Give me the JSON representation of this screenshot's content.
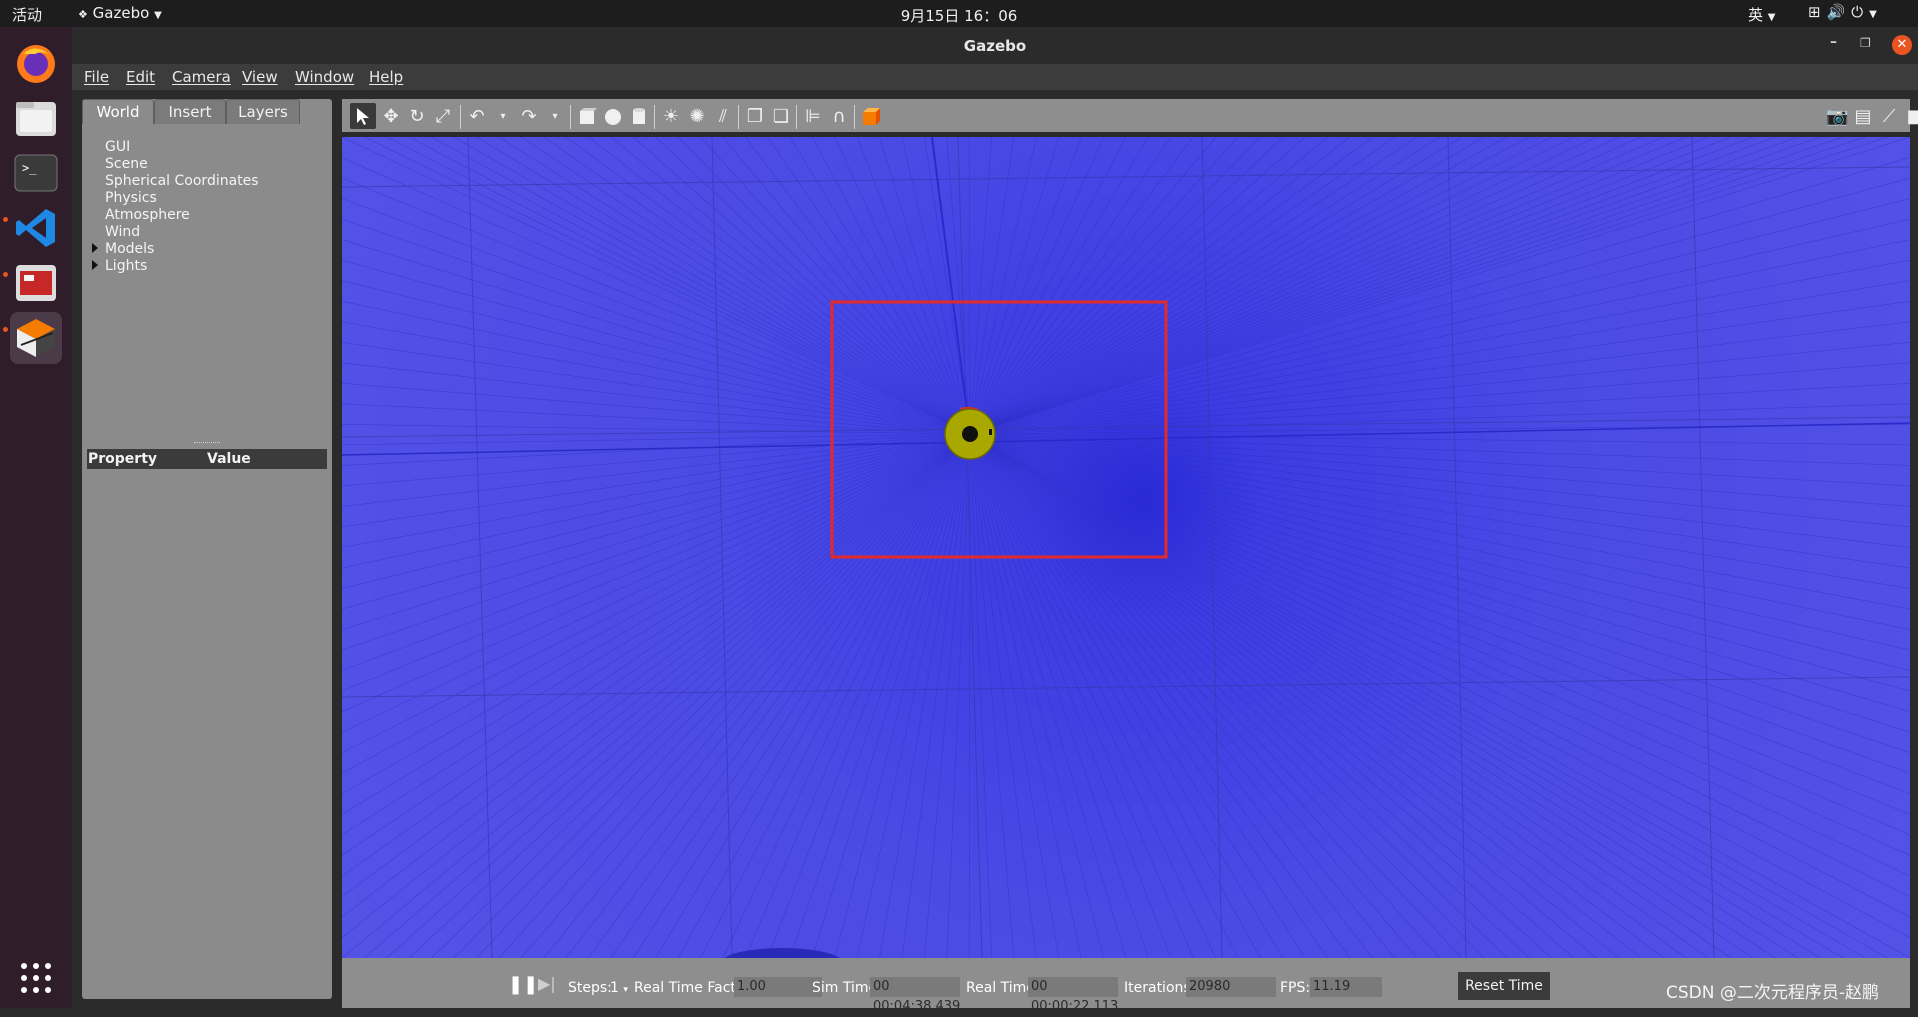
{
  "topbar": {
    "activities": "活动",
    "app_name": "Gazebo",
    "clock": "9月15日 16：06",
    "ime": "英"
  },
  "window": {
    "title": "Gazebo"
  },
  "menu": [
    "File",
    "Edit",
    "Camera",
    "View",
    "Window",
    "Help"
  ],
  "left_panel": {
    "tabs": [
      "World",
      "Insert",
      "Layers"
    ],
    "active_tab": "World",
    "tree": [
      "GUI",
      "Scene",
      "Spherical Coordinates",
      "Physics",
      "Atmosphere",
      "Wind",
      "Models",
      "Lights"
    ],
    "property_header": {
      "property": "Property",
      "value": "Value"
    }
  },
  "toolbar": {
    "tools": [
      "select-arrow-icon",
      "translate-icon",
      "rotate-icon",
      "scale-icon",
      "undo-icon",
      "undo-history-icon",
      "redo-icon",
      "redo-history-icon",
      "box-icon",
      "sphere-icon",
      "cylinder-icon",
      "point-light-icon",
      "spot-light-icon",
      "directional-light-icon",
      "copy-icon",
      "paste-icon",
      "align-icon",
      "snap-icon",
      "view-angle-icon"
    ],
    "right_tools": [
      "screenshot-icon",
      "log-icon",
      "plot-icon",
      "video-record-icon"
    ]
  },
  "bottom": {
    "steps_label": "Steps:",
    "steps_value": "1",
    "rtf_label": "Real Time Factor:",
    "rtf_value": "1.00",
    "sim_label": "Sim Time:",
    "sim_value": "00 00:04:38.439",
    "real_label": "Real Time:",
    "real_value": "00 00:00:22.113",
    "iter_label": "Iterations:",
    "iter_value": "20980",
    "fps_label": "FPS:",
    "fps_value": "11.19",
    "reset_label": "Reset Time"
  },
  "watermark": "CSDN @二次元程序员-赵鹏",
  "colors": {
    "ground": "#4a4ae5",
    "highlight_box": "#e22a2a",
    "robot": "#a8a800",
    "accent": "#e95420"
  }
}
